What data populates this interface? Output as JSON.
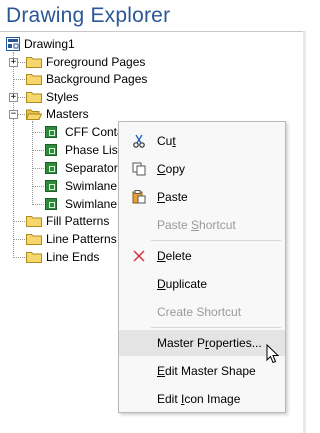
{
  "title": "Drawing Explorer",
  "tree": {
    "root": "Drawing1",
    "items": [
      {
        "label": "Foreground Pages",
        "expander": "+"
      },
      {
        "label": "Background Pages",
        "expander": ""
      },
      {
        "label": "Styles",
        "expander": "+"
      },
      {
        "label": "Masters",
        "expander": "−"
      },
      {
        "label": "CFF Conta"
      },
      {
        "label": "Phase List"
      },
      {
        "label": "Separator"
      },
      {
        "label": "Swimlane"
      },
      {
        "label": "Swimlane"
      },
      {
        "label": "Fill Patterns",
        "expander": ""
      },
      {
        "label": "Line Patterns",
        "expander": ""
      },
      {
        "label": "Line Ends",
        "expander": ""
      }
    ]
  },
  "context_menu": {
    "items": [
      {
        "pre": "Cu",
        "ul": "t",
        "post": "",
        "icon": "scissors-icon",
        "disabled": false
      },
      {
        "pre": "",
        "ul": "C",
        "post": "opy",
        "icon": "copy-icon",
        "disabled": false
      },
      {
        "pre": "",
        "ul": "P",
        "post": "aste",
        "icon": "paste-icon",
        "disabled": false
      },
      {
        "pre": "Paste ",
        "ul": "S",
        "post": "hortcut",
        "icon": "",
        "disabled": true
      },
      {
        "pre": "",
        "ul": "D",
        "post": "elete",
        "icon": "delete-x-icon",
        "disabled": false
      },
      {
        "pre": "",
        "ul": "D",
        "post": "uplicate",
        "icon": "",
        "disabled": false
      },
      {
        "pre": "Create Shortcut",
        "ul": "",
        "post": "",
        "icon": "",
        "disabled": true
      },
      {
        "pre": "Master P",
        "ul": "r",
        "post": "operties...",
        "icon": "",
        "disabled": false,
        "hover": true
      },
      {
        "pre": "",
        "ul": "E",
        "post": "dit Master Shape",
        "icon": "",
        "disabled": false
      },
      {
        "pre": "Edit ",
        "ul": "I",
        "post": "con Image",
        "icon": "",
        "disabled": false
      }
    ]
  },
  "colors": {
    "title": "#2b5797",
    "folder": "#f5d76e",
    "master_icon": "#2e8b3a",
    "delete_icon": "#d13438"
  }
}
